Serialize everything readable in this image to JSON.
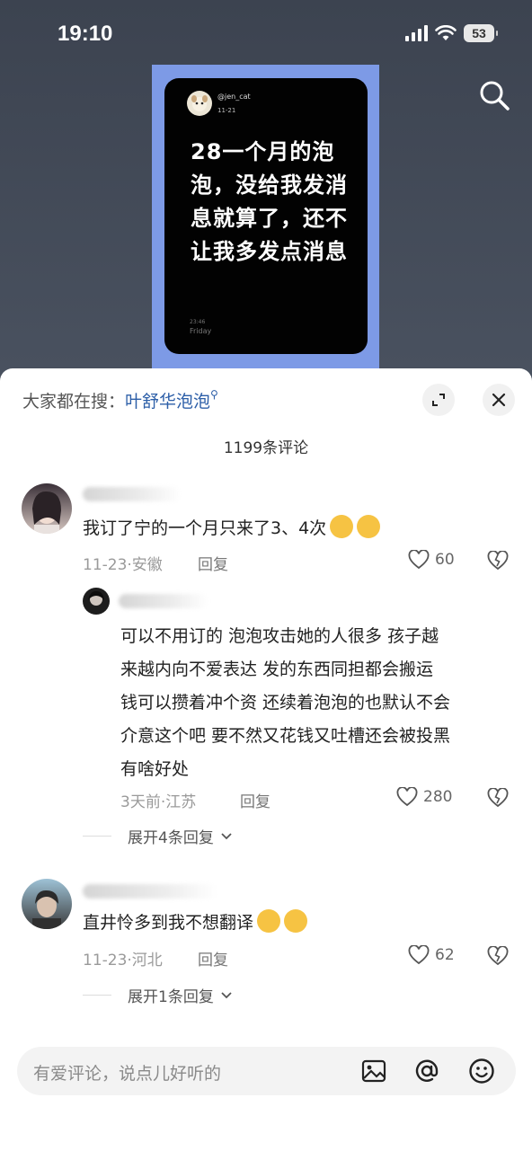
{
  "status_bar": {
    "time": "19:10",
    "battery": "53"
  },
  "post": {
    "handle": "@jen_cat",
    "date": "11-21",
    "text": "28一个月的泡泡，没给我发消息就算了，还不让我多发点消息",
    "time": "23:46",
    "day": "Friday"
  },
  "sheet": {
    "search_prefix": "大家都在搜：",
    "search_term": "叶舒华泡泡",
    "comment_count": "1199条评论"
  },
  "comments": [
    {
      "text": "我订了宁的一个月只来了3、4次",
      "meta": "11-23·安徽",
      "reply_label": "回复",
      "likes": "60"
    },
    {
      "text_lines": [
        "可以不用订的 泡泡攻击她的人很多 孩子越",
        "来越内向不爱表达 发的东西同担都会搬运",
        "钱可以攒着冲个资 还续着泡泡的也默认不会",
        "介意这个吧 要不然又花钱又吐槽还会被投黑",
        "有啥好处"
      ],
      "meta": "3天前·江苏",
      "reply_label": "回复",
      "likes": "280"
    },
    {
      "text": "直井怜多到我不想翻译",
      "meta": "11-23·河北",
      "reply_label": "回复",
      "likes": "62"
    }
  ],
  "expand_replies": [
    "展开4条回复",
    "展开1条回复"
  ],
  "input": {
    "placeholder": "有爱评论，说点儿好听的"
  },
  "icons": [
    "search-icon",
    "expand-icon",
    "close-icon",
    "heart-icon",
    "broken-heart-icon",
    "image-icon",
    "at-icon",
    "emoji-icon",
    "chevron-down-icon"
  ]
}
